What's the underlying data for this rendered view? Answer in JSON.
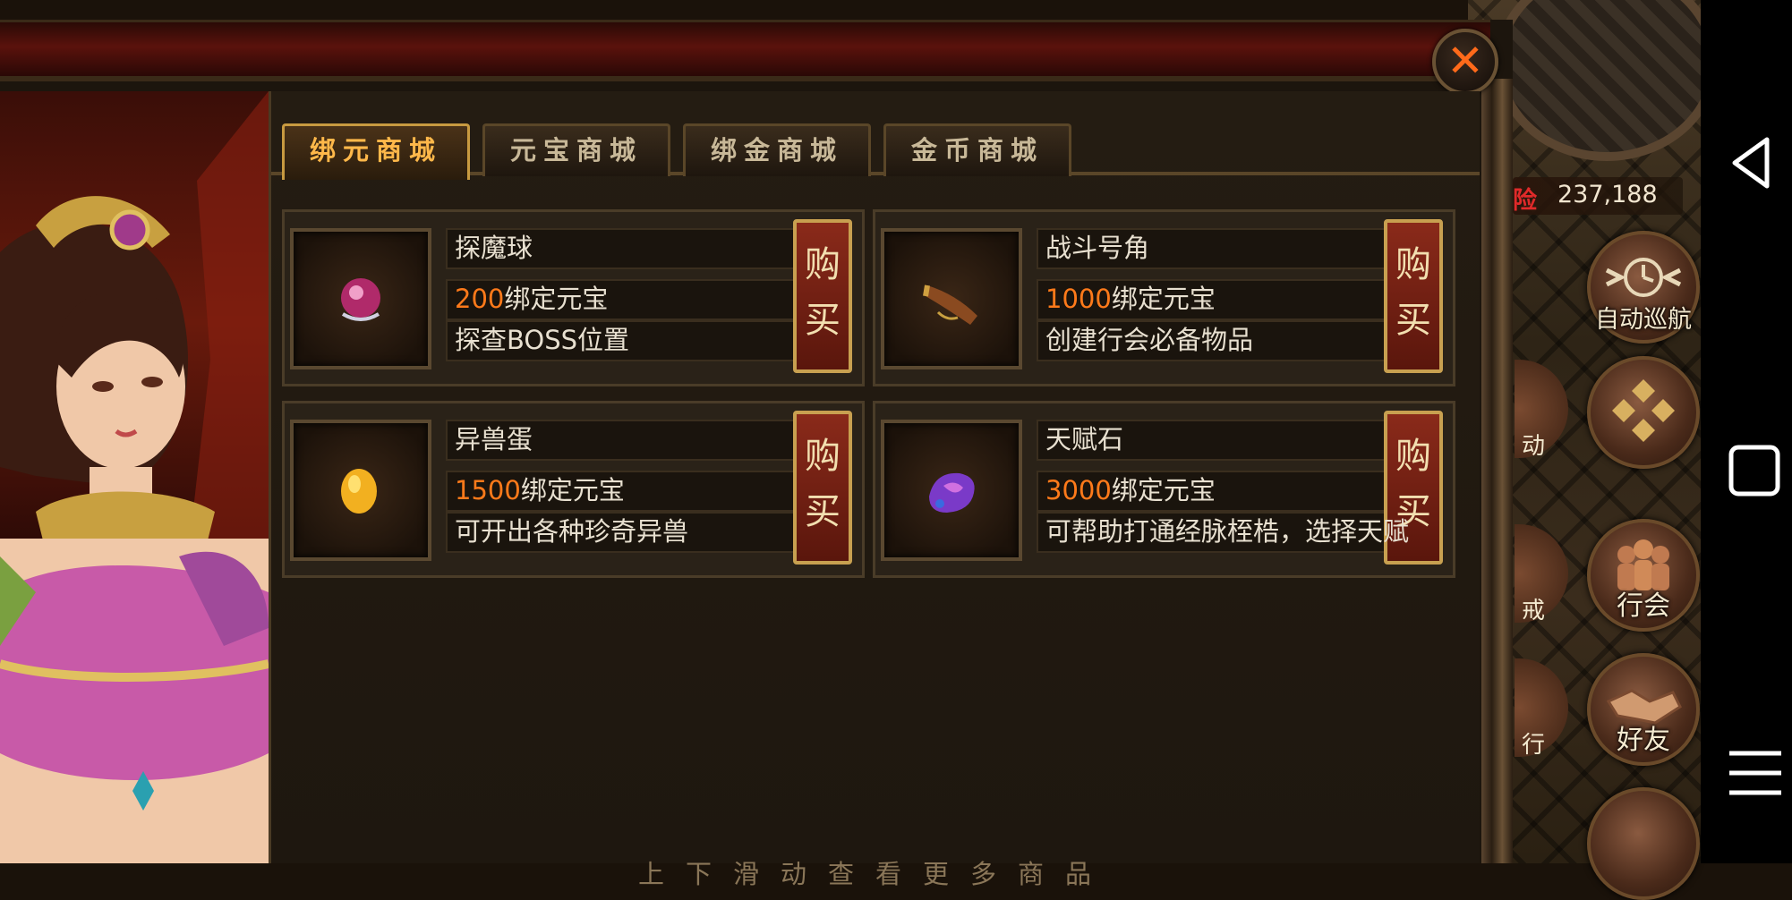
{
  "shop": {
    "tabs": [
      {
        "label": "绑元商城",
        "active": true
      },
      {
        "label": "元宝商城",
        "active": false
      },
      {
        "label": "绑金商城",
        "active": false
      },
      {
        "label": "金币商城",
        "active": false
      }
    ],
    "items": [
      {
        "name": "探魔球",
        "price": "200",
        "currency": "绑定元宝",
        "desc": "探查BOSS位置",
        "buy_label": "购买"
      },
      {
        "name": "战斗号角",
        "price": "1000",
        "currency": "绑定元宝",
        "desc": "创建行会必备物品",
        "buy_label": "购买"
      },
      {
        "name": "异兽蛋",
        "price": "1500",
        "currency": "绑定元宝",
        "desc": "可开出各种珍奇异兽",
        "buy_label": "购买"
      },
      {
        "name": "天赋石",
        "price": "3000",
        "currency": "绑定元宝",
        "desc": "可帮助打通经脉桎梏，选择天赋",
        "buy_label": "购买"
      }
    ],
    "scroll_hint": "上下滑动查看更多商品",
    "close_symbol": "✕"
  },
  "game_hud": {
    "exp_label": "险",
    "exp_value": "237,188",
    "buttons": [
      {
        "label": "自动巡航",
        "icon": "auto-navigate-icon"
      },
      {
        "label": "",
        "icon": "diamond-menu-icon"
      },
      {
        "label": "行会",
        "icon": "guild-icon"
      },
      {
        "label": "好友",
        "icon": "handshake-icon"
      }
    ],
    "partial_labels": [
      "动",
      "戒",
      "行"
    ]
  },
  "navbar": {
    "icons": [
      "back-icon",
      "home-icon",
      "menu-icon"
    ]
  },
  "colors": {
    "price": "#ff7a1a",
    "active_tab": "#ffb84a",
    "close_x": "#ff6a1a",
    "exp_red": "#e02a2a"
  }
}
